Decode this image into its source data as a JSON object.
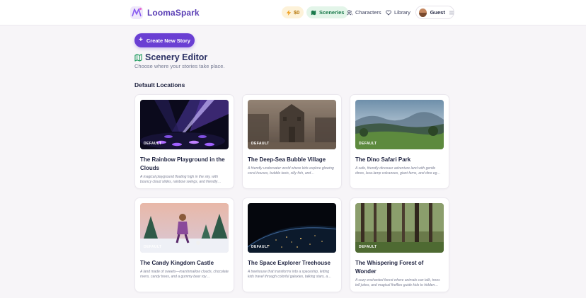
{
  "brand": {
    "name": "LoomaSpark"
  },
  "header": {
    "coins": "$0",
    "nav": {
      "sceneries": "Sceneries",
      "characters": "Characters",
      "library": "Library"
    },
    "user": "Guest"
  },
  "actions": {
    "create": "Create New Story"
  },
  "page": {
    "title": "Scenery Editor",
    "subtitle": "Choose where your stories take place.",
    "section": "Default Locations"
  },
  "cards": [
    {
      "badge": "DEFAULT",
      "title": "The Rainbow Playground in the Clouds",
      "desc": "A magical playground floating high in the sky, with bouncy cloud slides, rainbow swings, and friendly…"
    },
    {
      "badge": "DEFAULT",
      "title": "The Deep-Sea Bubble Village",
      "desc": "A friendly underwater world where kids explore glowing coral houses, bubble taxis, silly fish, and…"
    },
    {
      "badge": "DEFAULT",
      "title": "The Dino Safari Park",
      "desc": "A safe, friendly dinosaur adventure land with gentle dinos, lava-lamp volcanoes, giant ferns, and dino eg…"
    },
    {
      "badge": "DEFAULT",
      "title": "The Candy Kingdom Castle",
      "desc": "A land made of sweets—marshmallow clouds, chocolate rivers, candy trees, and a gummy bear roy…"
    },
    {
      "badge": "DEFAULT",
      "title": "The Space Explorer Treehouse",
      "desc": "A treehouse that transforms into a spaceship, letting kids travel through colorful galaxies, talking stars, a…"
    },
    {
      "badge": "DEFAULT",
      "title": "The Whispering Forest of Wonder",
      "desc": "A cozy enchanted forest where animals can talk, trees tell jokes, and magical fireflies guide kids to hidden…"
    }
  ],
  "colors": {
    "brand": "#5b3fb5",
    "primary": "#6a3fd3",
    "active_nav_bg": "#e3f5e9",
    "active_nav_text": "#1b7a4c",
    "coins": "#b5760a"
  }
}
